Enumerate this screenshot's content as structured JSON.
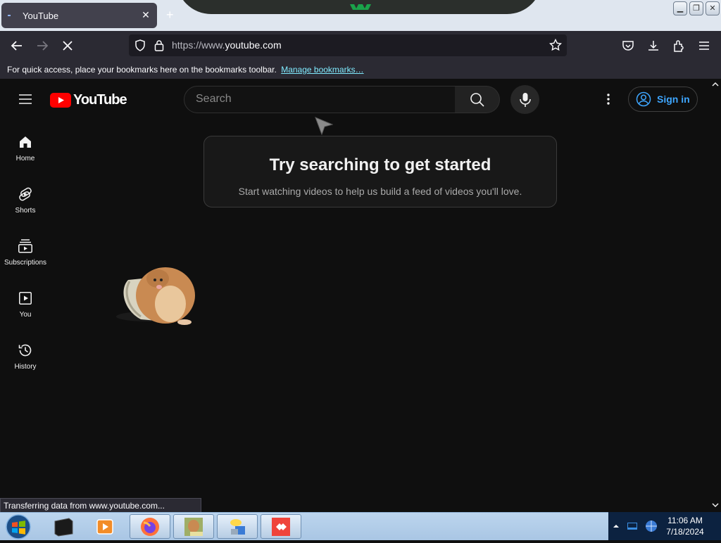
{
  "browser": {
    "tab_title": "YouTube",
    "url_prefix": "https://www.",
    "url_domain": "youtube.com",
    "bookmarks_message": "For quick access, place your bookmarks here on the bookmarks toolbar.",
    "bookmarks_link": "Manage bookmarks…",
    "status_text": "Transferring data from www.youtube.com..."
  },
  "youtube": {
    "logo_text": "YouTube",
    "search_placeholder": "Search",
    "sign_in_label": "Sign in",
    "sidebar": [
      {
        "label": "Home",
        "icon": "home-icon"
      },
      {
        "label": "Shorts",
        "icon": "shorts-icon"
      },
      {
        "label": "Subscriptions",
        "icon": "subscriptions-icon"
      },
      {
        "label": "You",
        "icon": "you-icon"
      },
      {
        "label": "History",
        "icon": "history-icon"
      }
    ],
    "empty_state": {
      "title": "Try searching to get started",
      "subtitle": "Start watching videos to help us build a feed of videos you'll love."
    }
  },
  "taskbar": {
    "time": "11:06 AM",
    "date": "7/18/2024"
  },
  "colors": {
    "youtube_red": "#ff0000",
    "link_blue": "#3ea6ff",
    "page_bg": "#0f0f0f"
  }
}
